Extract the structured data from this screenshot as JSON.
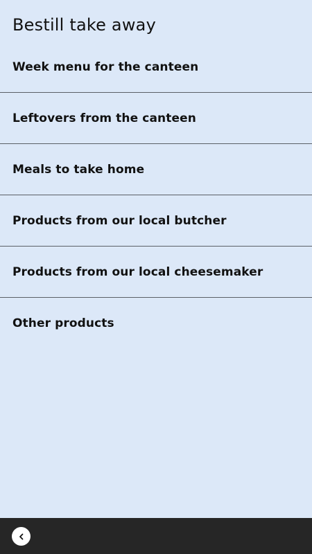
{
  "header": {
    "title": "Bestill take away"
  },
  "menu": {
    "items": [
      {
        "label": "Week menu for the canteen"
      },
      {
        "label": "Leftovers from the canteen"
      },
      {
        "label": "Meals to take home"
      },
      {
        "label": "Products from our local butcher"
      },
      {
        "label": "Products from our local cheesemaker"
      },
      {
        "label": "Other products"
      }
    ]
  },
  "bottom_bar": {
    "back_icon": "chevron-left-icon"
  },
  "colors": {
    "background": "#dce8f8",
    "divider": "#5a5f66",
    "bottom_bar": "#262626",
    "text": "#111111"
  }
}
